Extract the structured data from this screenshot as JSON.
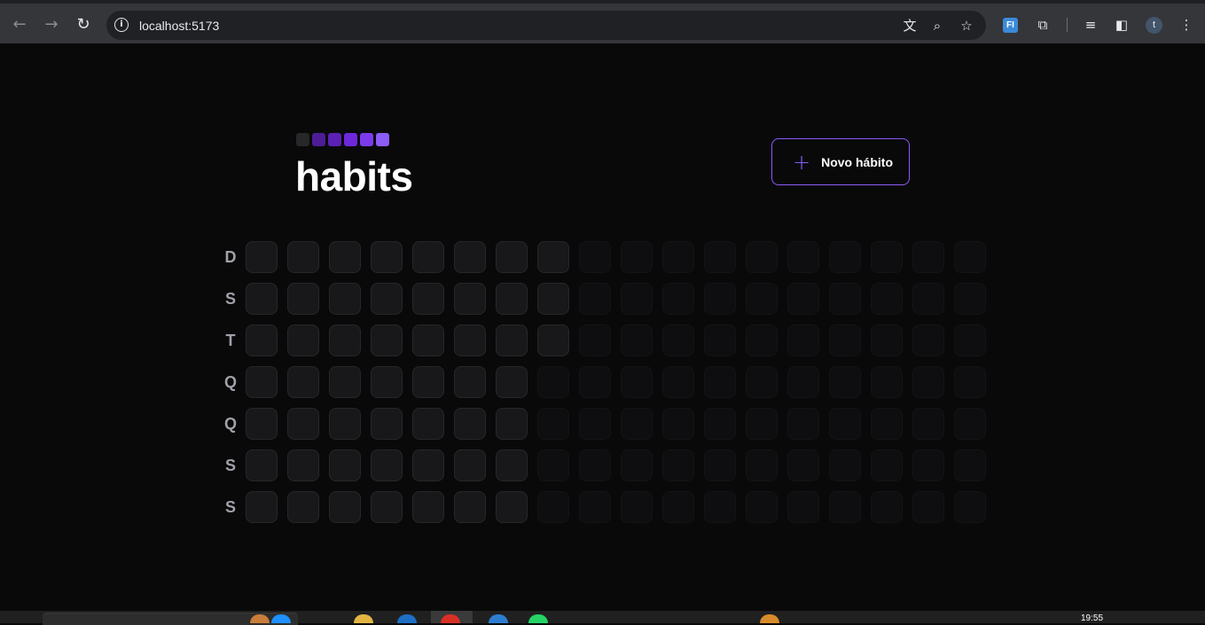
{
  "browser": {
    "url": "localhost:5173",
    "extension_label": "FI",
    "profile_initial": "t",
    "nav_icons": [
      "back-icon",
      "forward-icon",
      "reload-icon"
    ],
    "omnibox_icons": [
      "translate-icon",
      "zoom-icon",
      "bookmark-star-icon"
    ],
    "toolbar_icons": [
      "extensions-icon",
      "media-control-icon",
      "side-panel-icon",
      "menu-kebab-icon"
    ]
  },
  "header": {
    "title": "habits",
    "logo_colors": [
      "#27272a",
      "#4c1d95",
      "#5b21b6",
      "#6d28d9",
      "#7c3aed",
      "#8b5cf6"
    ],
    "new_habit_label": "Novo hábito"
  },
  "summary": {
    "week_days": [
      "D",
      "S",
      "T",
      "Q",
      "Q",
      "S",
      "S"
    ],
    "weeks": 18,
    "past_days": 52,
    "colors": {
      "day_bg": "#18181b",
      "day_border": "#27272a",
      "future_bg": "#0e0e10",
      "accent": "#8b5cf6"
    }
  },
  "taskbar": {
    "clock": "19:55"
  }
}
